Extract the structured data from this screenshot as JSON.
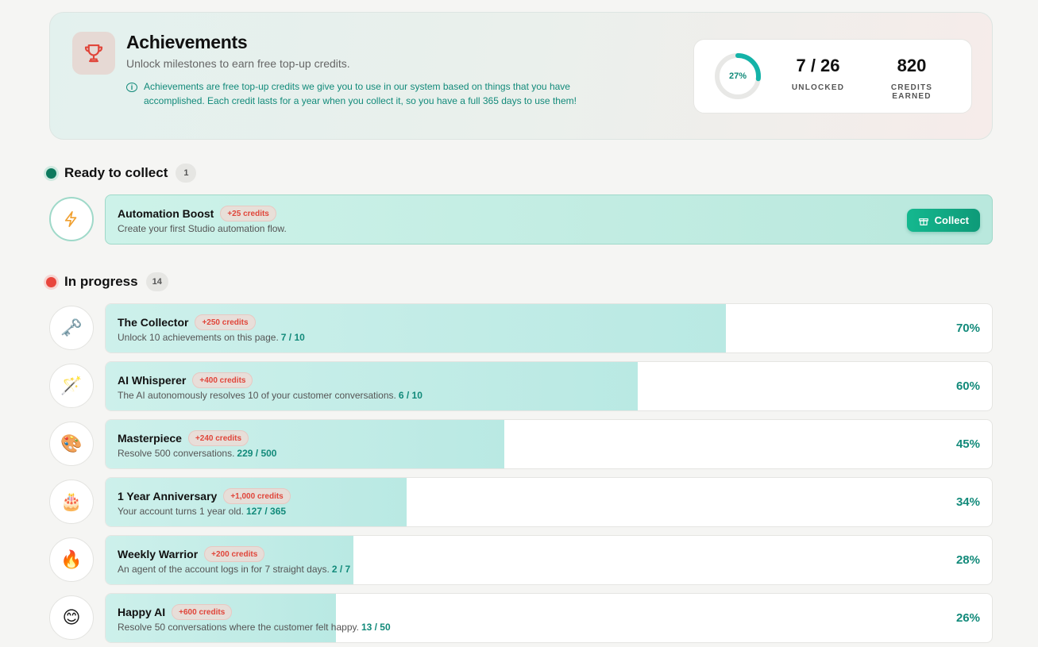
{
  "header": {
    "title": "Achievements",
    "subtitle": "Unlock milestones to earn free top-up credits.",
    "info": "Achievements are free top-up credits we give you to use in our system based on things that you have accomplished. Each credit lasts for a year when you collect it, so you have a full 365 days to use them!",
    "icon": "trophy-icon"
  },
  "stats": {
    "progress_fraction": 0.27,
    "progress_label": "27%",
    "unlocked_value": "7 / 26",
    "unlocked_label": "UNLOCKED",
    "credits_value": "820",
    "credits_label": "CREDITS EARNED"
  },
  "colors": {
    "accent": "#128a7a",
    "ready_dot": "#0e7a5e",
    "progress_dot": "#e8453c",
    "credit_badge": "#e0453a"
  },
  "ready": {
    "title": "Ready to collect",
    "count": "1",
    "items": [
      {
        "icon": "lightning-icon",
        "glyph": "⚡",
        "title": "Automation Boost",
        "credits": "+25 credits",
        "desc": "Create your first Studio automation flow.",
        "button": "Collect"
      }
    ]
  },
  "in_progress": {
    "title": "In progress",
    "count": "14",
    "items": [
      {
        "icon": "key-icon",
        "glyph": "🗝️",
        "title": "The Collector",
        "credits": "+250 credits",
        "desc": "Unlock 10 achievements on this page.",
        "progress": "7 / 10",
        "percent": "70%",
        "fraction": 0.7
      },
      {
        "icon": "magic-wand-icon",
        "glyph": "🪄",
        "title": "AI Whisperer",
        "credits": "+400 credits",
        "desc": "The AI autonomously resolves 10 of your customer conversations.",
        "progress": "6 / 10",
        "percent": "60%",
        "fraction": 0.6
      },
      {
        "icon": "palette-icon",
        "glyph": "🎨",
        "title": "Masterpiece",
        "credits": "+240 credits",
        "desc": "Resolve 500 conversations.",
        "progress": "229 / 500",
        "percent": "45%",
        "fraction": 0.45
      },
      {
        "icon": "cake-icon",
        "glyph": "🎂",
        "title": "1 Year Anniversary",
        "credits": "+1,000 credits",
        "desc": "Your account turns 1 year old.",
        "progress": "127 / 365",
        "percent": "34%",
        "fraction": 0.34
      },
      {
        "icon": "fire-icon",
        "glyph": "🔥",
        "title": "Weekly Warrior",
        "credits": "+200 credits",
        "desc": "An agent of the account logs in for 7 straight days.",
        "progress": "2 / 7",
        "percent": "28%",
        "fraction": 0.28
      },
      {
        "icon": "smile-icon",
        "glyph": "😊",
        "title": "Happy AI",
        "credits": "+600 credits",
        "desc": "Resolve 50 conversations where the customer felt happy.",
        "progress": "13 / 50",
        "percent": "26%",
        "fraction": 0.26
      }
    ]
  }
}
